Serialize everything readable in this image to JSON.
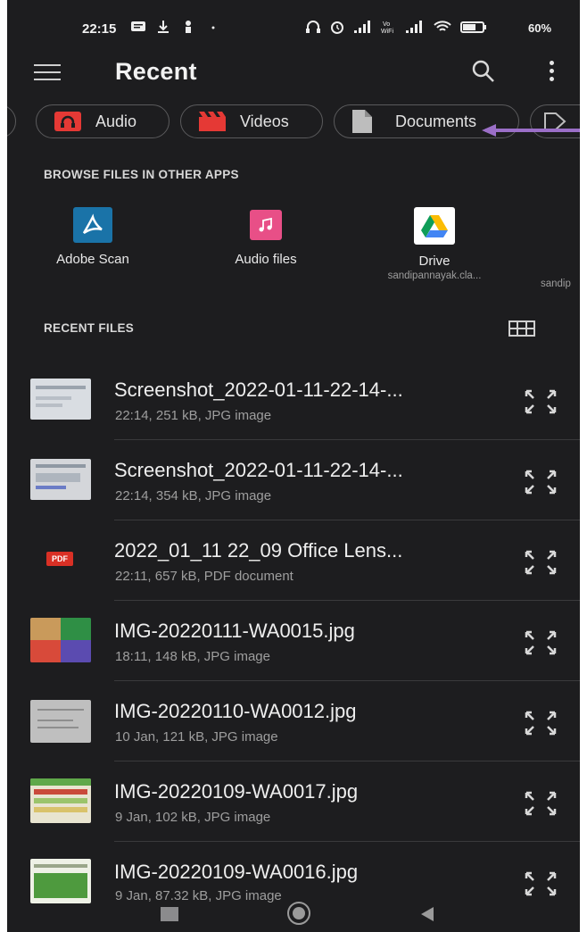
{
  "status_bar": {
    "time": "22:15",
    "battery": "60%"
  },
  "app_bar": {
    "title": "Recent",
    "icons": [
      "menu-icon",
      "search-icon",
      "more-vert-icon"
    ]
  },
  "chips": [
    {
      "label": "Audio",
      "icon": "audio-icon",
      "color": "#e53935"
    },
    {
      "label": "Videos",
      "icon": "video-clapper-icon",
      "color": "#e53935"
    },
    {
      "label": "Documents",
      "icon": "document-icon",
      "color": "#bdbdbd"
    }
  ],
  "browse_other_apps": {
    "heading": "BROWSE FILES IN OTHER APPS",
    "apps": [
      {
        "label": "Adobe Scan",
        "sub": "",
        "icon": "adobe-scan-icon",
        "color": "#1a73a8"
      },
      {
        "label": "Audio files",
        "sub": "",
        "icon": "music-note-icon",
        "color": "#e84f87"
      },
      {
        "label": "Drive",
        "sub": "sandipannayak.cla...",
        "icon": "google-drive-icon",
        "color": "#ffffff"
      },
      {
        "label": "",
        "sub": "sandip",
        "icon": "",
        "color": ""
      }
    ]
  },
  "recent_files": {
    "heading": "RECENT FILES",
    "view_toggle_icon": "grid-view-icon",
    "items": [
      {
        "name": "Screenshot_2022-01-11-22-14-...",
        "meta": "22:14, 251 kB, JPG image",
        "thumb": "screenshot-thumb"
      },
      {
        "name": "Screenshot_2022-01-11-22-14-...",
        "meta": "22:14, 354 kB, JPG image",
        "thumb": "screenshot-thumb"
      },
      {
        "name": "2022_01_11 22_09 Office Lens...",
        "meta": "22:11, 657 kB, PDF document",
        "thumb": "pdf-thumb",
        "badge": "PDF"
      },
      {
        "name": "IMG-20220111-WA0015.jpg",
        "meta": "18:11, 148 kB, JPG image",
        "thumb": "photo-thumb"
      },
      {
        "name": "IMG-20220110-WA0012.jpg",
        "meta": "10 Jan, 121 kB, JPG image",
        "thumb": "paper-thumb"
      },
      {
        "name": "IMG-20220109-WA0017.jpg",
        "meta": "9 Jan, 102 kB, JPG image",
        "thumb": "table-thumb"
      },
      {
        "name": "IMG-20220109-WA0016.jpg",
        "meta": "9 Jan, 87.32 kB, JPG image",
        "thumb": "table-thumb"
      }
    ]
  },
  "annotation_arrow_color": "#9b6fc7"
}
